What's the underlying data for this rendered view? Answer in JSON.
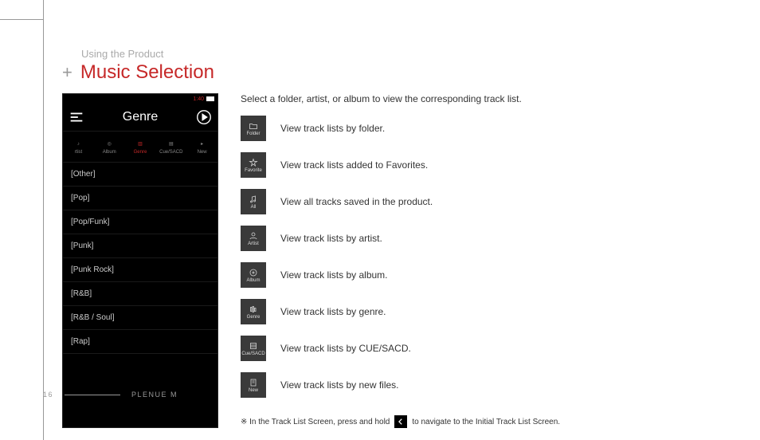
{
  "section_label": "Using the Product",
  "title": "Music Selection",
  "intro": "Select a folder, artist, or album to view the corresponding track list.",
  "device": {
    "status_time": "1:40",
    "screen_title": "Genre",
    "tabs": [
      "rtist",
      "Album",
      "Genre",
      "Cue/SACD",
      "New"
    ],
    "active_tab": 2,
    "list": [
      "[Other]",
      "[Pop]",
      "[Pop/Funk]",
      "[Punk]",
      "[Punk Rock]",
      "[R&B]",
      "[R&B / Soul]",
      "[Rap]"
    ]
  },
  "descriptions": [
    {
      "badge": "Folder",
      "text": "View track lists by folder."
    },
    {
      "badge": "Favorite",
      "text": "View track lists added to Favorites."
    },
    {
      "badge": "All",
      "text": "View all tracks saved in the product."
    },
    {
      "badge": "Artist",
      "text": "View track lists by artist."
    },
    {
      "badge": "Album",
      "text": "View track lists by album."
    },
    {
      "badge": "Genre",
      "text": "View track lists by genre."
    },
    {
      "badge": "Cue/SACD",
      "text": "View track lists by CUE/SACD."
    },
    {
      "badge": "New",
      "text": "View track lists by new files."
    }
  ],
  "footnote_pre": "※ In the Track List Screen, press and hold",
  "footnote_post": "to navigate to the Initial Track List Screen.",
  "footer": {
    "page": "16",
    "product": "PLENUE M"
  }
}
